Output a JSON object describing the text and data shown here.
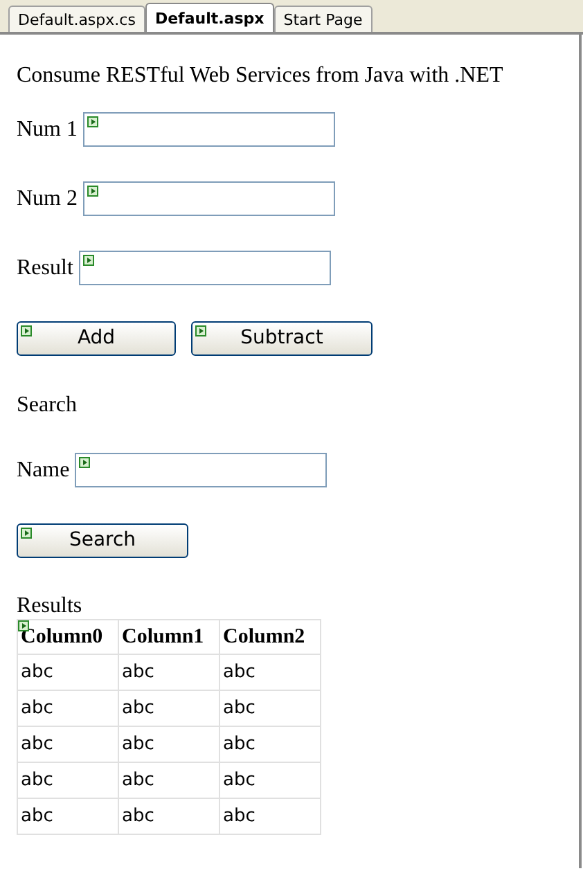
{
  "tabs": [
    {
      "label": "Default.aspx.cs",
      "selected": false
    },
    {
      "label": "Default.aspx",
      "selected": true
    },
    {
      "label": "Start Page",
      "selected": false
    }
  ],
  "heading": "Consume RESTful Web Services from Java with .NET",
  "fields": [
    {
      "label": "Num 1"
    },
    {
      "label": "Num 2"
    },
    {
      "label": "Result"
    }
  ],
  "buttons": [
    "Add",
    "Subtract"
  ],
  "search": {
    "heading": "Search",
    "field_label": "Name",
    "button": "Search"
  },
  "results": {
    "heading": "Results",
    "columns": [
      "Column0",
      "Column1",
      "Column2"
    ],
    "rows": [
      [
        "abc",
        "abc",
        "abc"
      ],
      [
        "abc",
        "abc",
        "abc"
      ],
      [
        "abc",
        "abc",
        "abc"
      ],
      [
        "abc",
        "abc",
        "abc"
      ],
      [
        "abc",
        "abc",
        "abc"
      ]
    ]
  }
}
